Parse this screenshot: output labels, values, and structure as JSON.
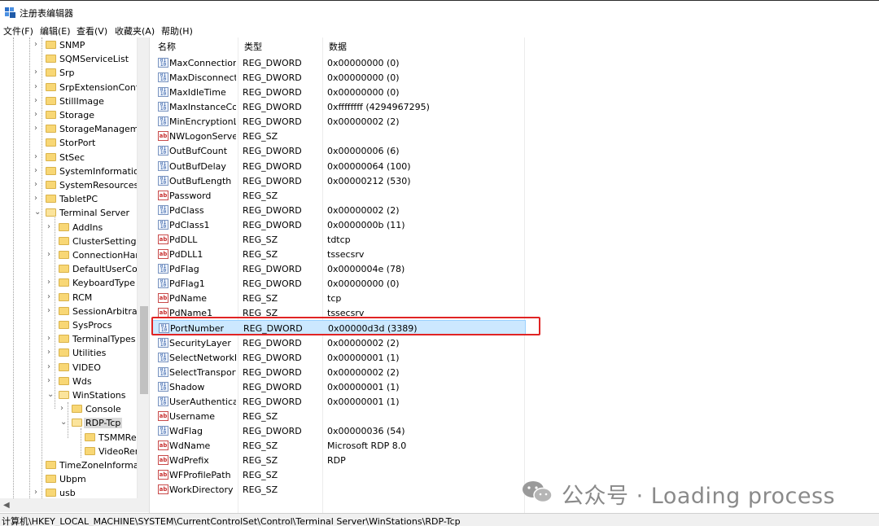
{
  "window": {
    "title": "注册表编辑器"
  },
  "menu": [
    "文件(F)",
    "编辑(E)",
    "查看(V)",
    "收藏夹(A)",
    "帮助(H)"
  ],
  "tree": [
    {
      "label": "SNMP",
      "indent": 1,
      "expander": "›"
    },
    {
      "label": "SQMServiceList",
      "indent": 1,
      "expander": ""
    },
    {
      "label": "Srp",
      "indent": 1,
      "expander": "›"
    },
    {
      "label": "SrpExtensionConfig",
      "indent": 1,
      "expander": "›"
    },
    {
      "label": "StillImage",
      "indent": 1,
      "expander": "›"
    },
    {
      "label": "Storage",
      "indent": 1,
      "expander": "›"
    },
    {
      "label": "StorageManagement",
      "indent": 1,
      "expander": "›"
    },
    {
      "label": "StorPort",
      "indent": 1,
      "expander": ""
    },
    {
      "label": "StSec",
      "indent": 1,
      "expander": "›"
    },
    {
      "label": "SystemInformation",
      "indent": 1,
      "expander": "›"
    },
    {
      "label": "SystemResources",
      "indent": 1,
      "expander": "›"
    },
    {
      "label": "TabletPC",
      "indent": 1,
      "expander": "›"
    },
    {
      "label": "Terminal Server",
      "indent": 1,
      "expander": "⌄"
    },
    {
      "label": "AddIns",
      "indent": 2,
      "expander": "›"
    },
    {
      "label": "ClusterSettings",
      "indent": 2,
      "expander": ""
    },
    {
      "label": "ConnectionHandler",
      "indent": 2,
      "expander": "›"
    },
    {
      "label": "DefaultUserConfiguration",
      "indent": 2,
      "expander": ""
    },
    {
      "label": "KeyboardType",
      "indent": 2,
      "expander": "›"
    },
    {
      "label": "RCM",
      "indent": 2,
      "expander": "›"
    },
    {
      "label": "SessionArbitration",
      "indent": 2,
      "expander": "›"
    },
    {
      "label": "SysProcs",
      "indent": 2,
      "expander": ""
    },
    {
      "label": "TerminalTypes",
      "indent": 2,
      "expander": "›"
    },
    {
      "label": "Utilities",
      "indent": 2,
      "expander": "›"
    },
    {
      "label": "VIDEO",
      "indent": 2,
      "expander": "›"
    },
    {
      "label": "Wds",
      "indent": 2,
      "expander": "›"
    },
    {
      "label": "WinStations",
      "indent": 2,
      "expander": "⌄"
    },
    {
      "label": "Console",
      "indent": 3,
      "expander": "›"
    },
    {
      "label": "RDP-Tcp",
      "indent": 3,
      "expander": "⌄",
      "selected": true
    },
    {
      "label": "TSMMRemotingAllowedApps",
      "indent": 4,
      "expander": ""
    },
    {
      "label": "VideoRemotingWindowNames",
      "indent": 4,
      "expander": ""
    },
    {
      "label": "TimeZoneInformation",
      "indent": 1,
      "expander": ""
    },
    {
      "label": "Ubpm",
      "indent": 1,
      "expander": ""
    },
    {
      "label": "usb",
      "indent": 1,
      "expander": "›"
    }
  ],
  "columns": {
    "name": "名称",
    "type": "类型",
    "data": "数据"
  },
  "rows": [
    {
      "name": "MaxConnectionTime",
      "type": "REG_DWORD",
      "data": "0x00000000 (0)",
      "icon": "dword"
    },
    {
      "name": "MaxDisconnectionTime",
      "type": "REG_DWORD",
      "data": "0x00000000 (0)",
      "icon": "dword"
    },
    {
      "name": "MaxIdleTime",
      "type": "REG_DWORD",
      "data": "0x00000000 (0)",
      "icon": "dword"
    },
    {
      "name": "MaxInstanceCount",
      "type": "REG_DWORD",
      "data": "0xffffffff (4294967295)",
      "icon": "dword"
    },
    {
      "name": "MinEncryptionLevel",
      "type": "REG_DWORD",
      "data": "0x00000002 (2)",
      "icon": "dword"
    },
    {
      "name": "NWLogonServer",
      "type": "REG_SZ",
      "data": "",
      "icon": "sz"
    },
    {
      "name": "OutBufCount",
      "type": "REG_DWORD",
      "data": "0x00000006 (6)",
      "icon": "dword"
    },
    {
      "name": "OutBufDelay",
      "type": "REG_DWORD",
      "data": "0x00000064 (100)",
      "icon": "dword"
    },
    {
      "name": "OutBufLength",
      "type": "REG_DWORD",
      "data": "0x00000212 (530)",
      "icon": "dword"
    },
    {
      "name": "Password",
      "type": "REG_SZ",
      "data": "",
      "icon": "sz"
    },
    {
      "name": "PdClass",
      "type": "REG_DWORD",
      "data": "0x00000002 (2)",
      "icon": "dword"
    },
    {
      "name": "PdClass1",
      "type": "REG_DWORD",
      "data": "0x0000000b (11)",
      "icon": "dword"
    },
    {
      "name": "PdDLL",
      "type": "REG_SZ",
      "data": "tdtcp",
      "icon": "sz"
    },
    {
      "name": "PdDLL1",
      "type": "REG_SZ",
      "data": "tssecsrv",
      "icon": "sz"
    },
    {
      "name": "PdFlag",
      "type": "REG_DWORD",
      "data": "0x0000004e (78)",
      "icon": "dword"
    },
    {
      "name": "PdFlag1",
      "type": "REG_DWORD",
      "data": "0x00000000 (0)",
      "icon": "dword"
    },
    {
      "name": "PdName",
      "type": "REG_SZ",
      "data": "tcp",
      "icon": "sz"
    },
    {
      "name": "PdName1",
      "type": "REG_SZ",
      "data": "tssecsrv",
      "icon": "sz"
    },
    {
      "name": "PortNumber",
      "type": "REG_DWORD",
      "data": "0x00000d3d (3389)",
      "icon": "dword",
      "selected": true
    },
    {
      "name": "SecurityLayer",
      "type": "REG_DWORD",
      "data": "0x00000002 (2)",
      "icon": "dword"
    },
    {
      "name": "SelectNetworkDetect",
      "type": "REG_DWORD",
      "data": "0x00000001 (1)",
      "icon": "dword"
    },
    {
      "name": "SelectTransport",
      "type": "REG_DWORD",
      "data": "0x00000002 (2)",
      "icon": "dword"
    },
    {
      "name": "Shadow",
      "type": "REG_DWORD",
      "data": "0x00000001 (1)",
      "icon": "dword"
    },
    {
      "name": "UserAuthentication",
      "type": "REG_DWORD",
      "data": "0x00000001 (1)",
      "icon": "dword"
    },
    {
      "name": "Username",
      "type": "REG_SZ",
      "data": "",
      "icon": "sz"
    },
    {
      "name": "WdFlag",
      "type": "REG_DWORD",
      "data": "0x00000036 (54)",
      "icon": "dword"
    },
    {
      "name": "WdName",
      "type": "REG_SZ",
      "data": "Microsoft RDP 8.0",
      "icon": "sz"
    },
    {
      "name": "WdPrefix",
      "type": "REG_SZ",
      "data": "RDP",
      "icon": "sz"
    },
    {
      "name": "WFProfilePath",
      "type": "REG_SZ",
      "data": "",
      "icon": "sz"
    },
    {
      "name": "WorkDirectory",
      "type": "REG_SZ",
      "data": "",
      "icon": "sz"
    }
  ],
  "status": {
    "path": "计算机\\HKEY_LOCAL_MACHINE\\SYSTEM\\CurrentControlSet\\Control\\Terminal Server\\WinStations\\RDP-Tcp"
  },
  "watermark": {
    "text": "公众号 · Loading process"
  },
  "colors": {
    "highlight_box": "#e02424",
    "selection": "#cce8ff",
    "folder": "#f8d775"
  }
}
